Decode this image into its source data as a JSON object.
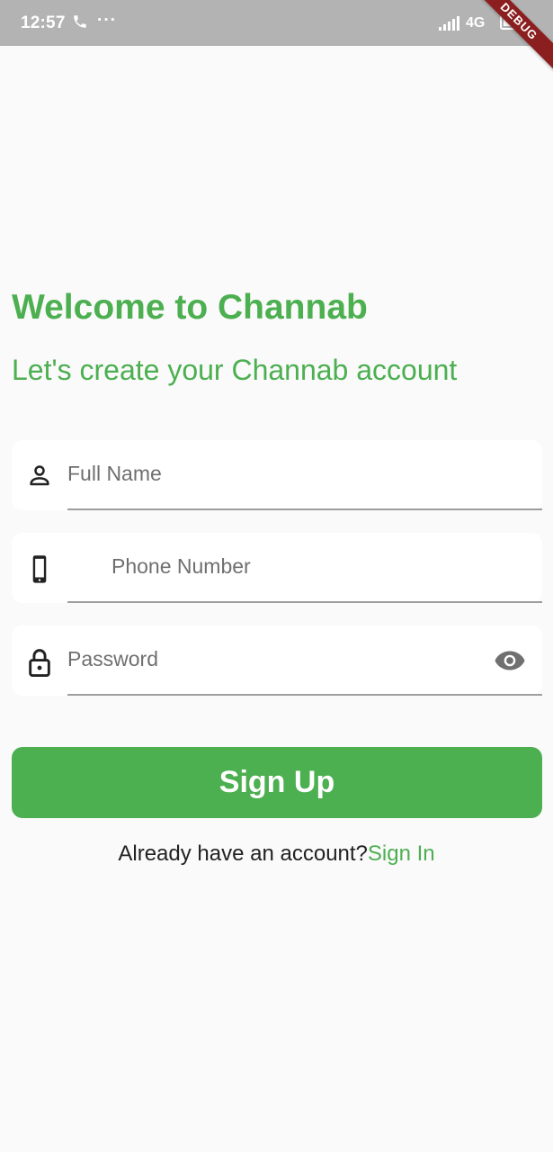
{
  "status_bar": {
    "time": "12:57",
    "dots": "···",
    "network": "4G",
    "debug_label": "DEBUG"
  },
  "header": {
    "title": "Welcome to Channab",
    "subtitle": "Let's create your Channab account"
  },
  "form": {
    "full_name_placeholder": "Full Name",
    "phone_placeholder": "Phone Number",
    "password_placeholder": "Password"
  },
  "actions": {
    "signup_label": "Sign Up",
    "have_account_text": "Already have an account?",
    "signin_link": "Sign In"
  },
  "colors": {
    "accent": "#4caf50",
    "background": "#fafafa",
    "status_bar": "#b3b3b3",
    "debug_banner": "#8b1e1e"
  },
  "icons": {
    "full_name": "person-icon",
    "phone": "smartphone-icon",
    "password": "lock-icon",
    "visibility": "eye-icon"
  }
}
